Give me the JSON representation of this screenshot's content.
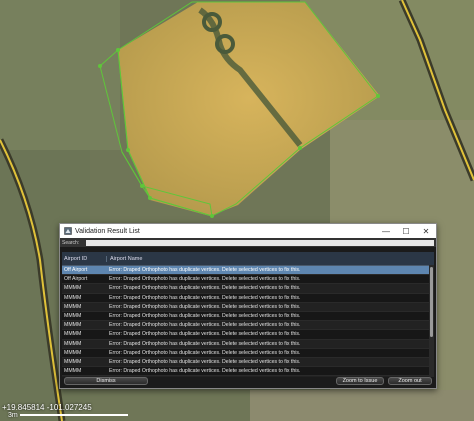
{
  "map": {
    "coordinates": "+19.845814 -101.027245",
    "scale_label": "3m"
  },
  "dialog": {
    "title": "Validation Result List",
    "search_label": "Search:",
    "search_value": "",
    "columns": [
      "Airport ID",
      "Airport Name"
    ],
    "rows": [
      {
        "id": "Off Airport",
        "msg": "Error: Draped Orthophoto has duplicate vertices. Delete selected vertices to fix this.",
        "selected": true
      },
      {
        "id": "Off Airport",
        "msg": "Error: Draped Orthophoto has duplicate vertices. Delete selected vertices to fix this.",
        "selected": false
      },
      {
        "id": "MMMM",
        "msg": "Error: Draped Orthophoto has duplicate vertices. Delete selected vertices to fix this.",
        "selected": false
      },
      {
        "id": "MMMM",
        "msg": "Error: Draped Orthophoto has duplicate vertices. Delete selected vertices to fix this.",
        "selected": false
      },
      {
        "id": "MMMM",
        "msg": "Error: Draped Orthophoto has duplicate vertices. Delete selected vertices to fix this.",
        "selected": false
      },
      {
        "id": "MMMM",
        "msg": "Error: Draped Orthophoto has duplicate vertices. Delete selected vertices to fix this.",
        "selected": false
      },
      {
        "id": "MMMM",
        "msg": "Error: Draped Orthophoto has duplicate vertices. Delete selected vertices to fix this.",
        "selected": false
      },
      {
        "id": "MMMM",
        "msg": "Error: Draped Orthophoto has duplicate vertices. Delete selected vertices to fix this.",
        "selected": false
      },
      {
        "id": "MMMM",
        "msg": "Error: Draped Orthophoto has duplicate vertices. Delete selected vertices to fix this.",
        "selected": false
      },
      {
        "id": "MMMM",
        "msg": "Error: Draped Orthophoto has duplicate vertices. Delete selected vertices to fix this.",
        "selected": false
      },
      {
        "id": "MMMM",
        "msg": "Error: Draped Orthophoto has duplicate vertices. Delete selected vertices to fix this.",
        "selected": false
      },
      {
        "id": "MMMM",
        "msg": "Error: Draped Orthophoto has duplicate vertices. Delete selected vertices to fix this.",
        "selected": false
      },
      {
        "id": "MMMM",
        "msg": "Error: Draped Orthophoto has duplicate vertices. Delete selected vertices to fix this.",
        "selected": false
      },
      {
        "id": "MMMM",
        "msg": "Error: Draped Orthophoto has duplicate vertices. Delete selected vertices to fix this.",
        "selected": false
      }
    ],
    "buttons": {
      "dismiss": "Dismiss",
      "zoom_to_issue": "Zoom to Issue",
      "zoom_out": "Zoom out"
    },
    "window_controls": {
      "minimize": "—",
      "maximize": "☐",
      "close": "✕"
    }
  },
  "colors": {
    "selection": "#5e86b0",
    "polygon_stroke": "#5fc63a",
    "header_bg": "#2b3746"
  }
}
